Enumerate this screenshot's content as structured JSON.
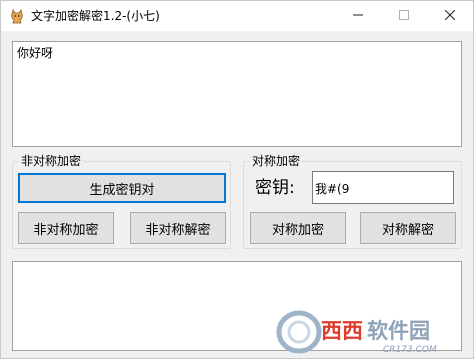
{
  "window": {
    "title": "文字加密解密1.2-(小七)"
  },
  "input": {
    "value": "你好呀"
  },
  "asymmetric": {
    "group_title": "非对称加密",
    "generate_label": "生成密钥对",
    "encrypt_label": "非对称加密",
    "decrypt_label": "非对称解密"
  },
  "symmetric": {
    "group_title": "对称加密",
    "key_label": "密钥:",
    "key_value": "我#(9",
    "encrypt_label": "对称加密",
    "decrypt_label": "对称解密"
  },
  "output": {
    "value": ""
  },
  "watermark": {
    "text": "西西软件园",
    "url": "CR173.COM"
  },
  "colors": {
    "accent": "#0078d7",
    "window_bg": "#f0f0f0",
    "button_bg": "#e1e1e1",
    "watermark_red": "#e03c2d"
  },
  "icons": {
    "app": "cat-icon",
    "minimize": "minimize-icon",
    "maximize": "maximize-icon",
    "close": "close-icon"
  }
}
